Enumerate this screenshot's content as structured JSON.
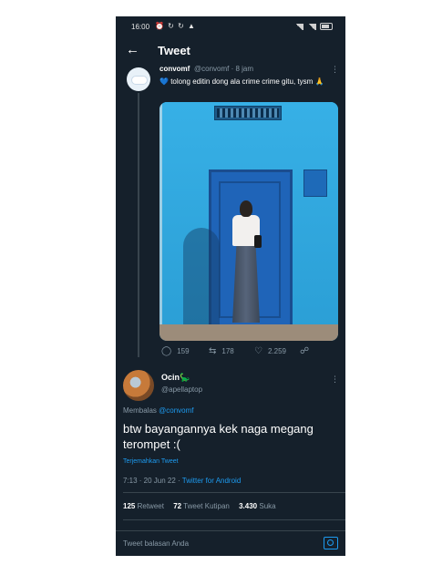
{
  "status_bar": {
    "time": "16:00",
    "left_icons": "⏰ ↻ ↻ ▲"
  },
  "header": {
    "title": "Tweet"
  },
  "original_tweet": {
    "display_name": "convomf",
    "handle_time": "@convomf · 8 jam",
    "text": "tolong editin dong ala crime crime gitu, tysm 🙏",
    "heart_emoji": "💙",
    "replies": "159",
    "retweets": "178",
    "likes": "2.259"
  },
  "reply_tweet": {
    "display_name": "Ocin🦕",
    "handle": "@apellaptop",
    "replying_label": "Membalas",
    "replying_to": "@convomf",
    "text": "btw bayangannya kek naga megang terompet :(",
    "translate_label": "Terjemahkan Tweet",
    "timestamp": "7:13 · 20 Jun 22 · ",
    "source": "Twitter for Android",
    "stats": {
      "retweets_count": "125",
      "retweets_label": "Retweet",
      "quotes_count": "72",
      "quotes_label": "Tweet Kutipan",
      "likes_count": "3.430",
      "likes_label": "Suka"
    }
  },
  "composer": {
    "placeholder": "Tweet balasan Anda"
  },
  "colors": {
    "background": "#15202b",
    "accent": "#1d9bf0",
    "muted": "#8899a6"
  },
  "icons": [
    "back-arrow-icon",
    "more-icon",
    "reply-icon",
    "retweet-icon",
    "like-icon",
    "share-icon",
    "camera-icon"
  ]
}
